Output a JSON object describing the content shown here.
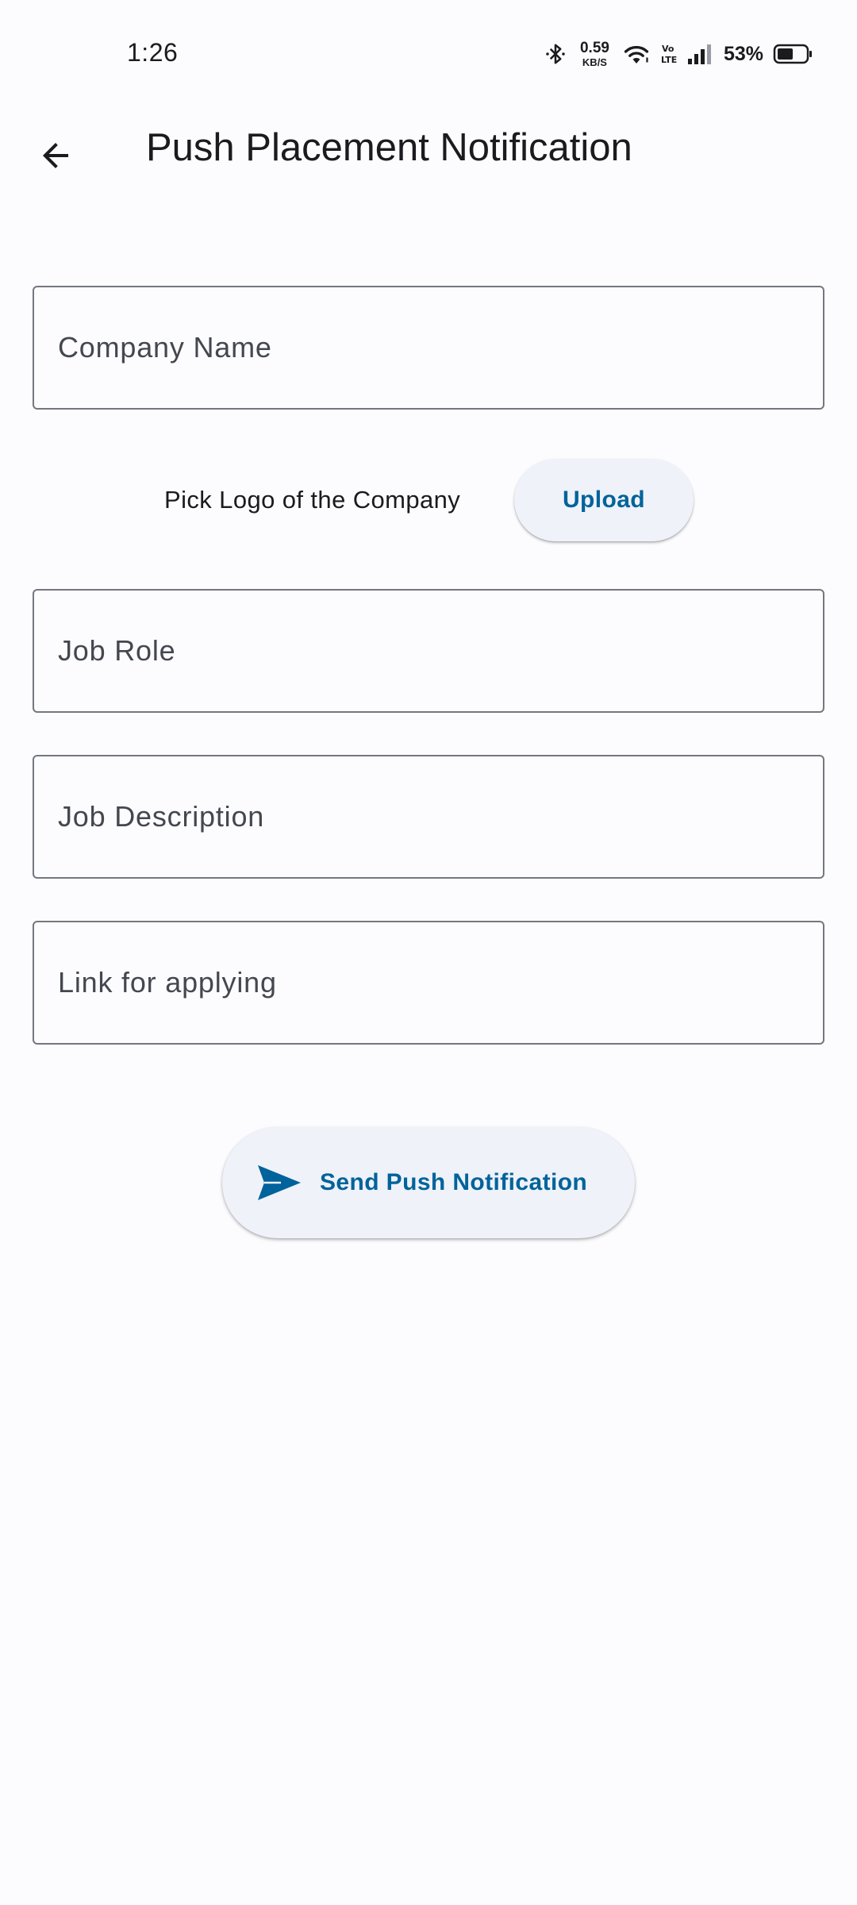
{
  "status_bar": {
    "time": "1:26",
    "net_speed_value": "0.59",
    "net_speed_unit": "KB/S",
    "battery_percent": "53%",
    "icons": [
      "bluetooth-icon",
      "wifi-icon",
      "volte-icon",
      "signal-icon",
      "battery-icon"
    ]
  },
  "app_bar": {
    "title": "Push Placement Notification",
    "back_icon": "arrow-back-icon"
  },
  "form": {
    "company_name_placeholder": "Company Name",
    "logo_label": "Pick Logo of the Company",
    "upload_label": "Upload",
    "job_role_placeholder": "Job Role",
    "job_description_placeholder": "Job Description",
    "apply_link_placeholder": "Link for applying",
    "send_label": "Send Push Notification",
    "send_icon": "send-icon"
  },
  "colors": {
    "background": "#fcfcff",
    "accent": "#00639b",
    "button_surface": "#eff2f9",
    "outline": "#74777f"
  }
}
